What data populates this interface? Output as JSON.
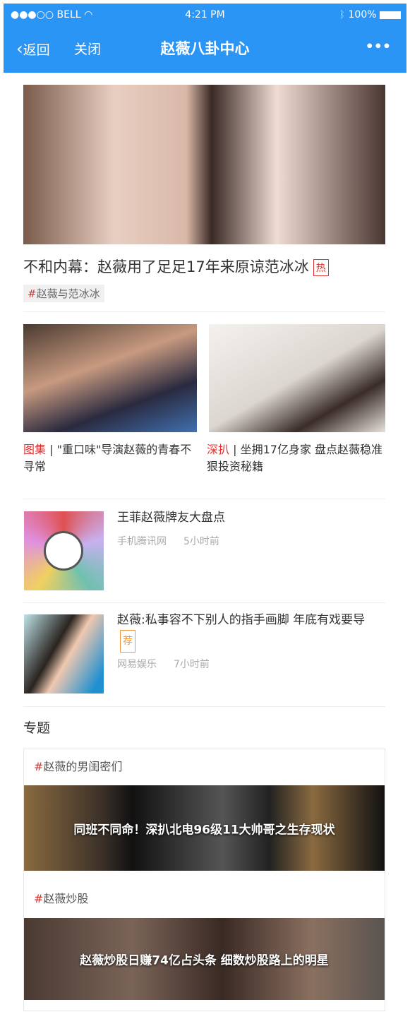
{
  "status_bar": {
    "carrier": "BELL",
    "time": "4:21 PM",
    "battery": "100%"
  },
  "header": {
    "back": "返回",
    "close": "关闭",
    "title": "赵薇八卦中心",
    "more": "•••"
  },
  "hero": {
    "title": "不和内幕：赵薇用了足足17年来原谅范冰冰",
    "badge": "热",
    "tag_hash": "#",
    "tag": "赵薇与范冰冰"
  },
  "grid": [
    {
      "category": "图集",
      "separator": " | ",
      "title": "\"重口味\"导演赵薇的青春不寻常"
    },
    {
      "category": "深扒",
      "separator": " | ",
      "title": "坐拥17亿身家 盘点赵薇稳准狠投资秘籍"
    }
  ],
  "list": [
    {
      "title": "王菲赵薇牌友大盘点",
      "source": "手机腾讯网",
      "time": "5小时前"
    },
    {
      "title": "赵薇:私事容不下别人的指手画脚 年底有戏要导",
      "badge": "荐",
      "source": "网易娱乐",
      "time": "7小时前"
    }
  ],
  "topics": {
    "heading": "专题",
    "items": [
      {
        "hash": "#",
        "tag": "赵薇的男闺密们",
        "banner": "同班不同命！深扒北电96级11大帅哥之生存现状"
      },
      {
        "hash": "#",
        "tag": "赵薇炒股",
        "banner": "赵薇炒股日赚74亿占头条 细数炒股路上的明星"
      }
    ]
  },
  "colors": {
    "header": "#2a95f5",
    "accent_red": "#d33333",
    "recommend_orange": "#f39539"
  }
}
